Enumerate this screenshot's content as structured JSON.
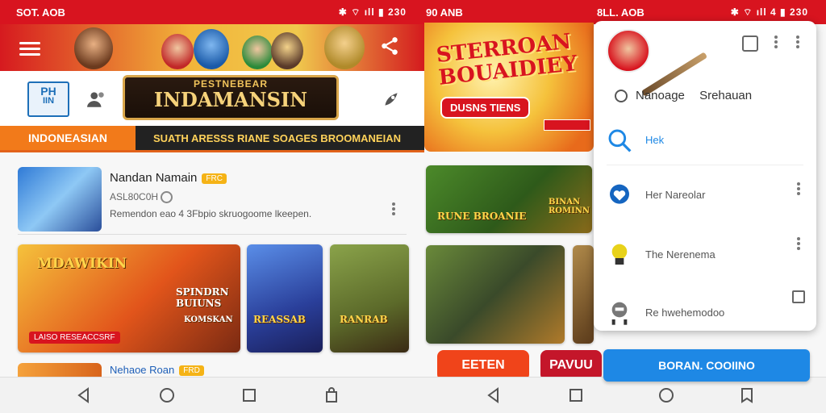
{
  "left_screen": {
    "status": {
      "time": "SOT. AOB",
      "right": "✱ ⌔ ıll ▮ 230"
    },
    "banner": {
      "logo_text": "PH",
      "logo_text2": "IIN",
      "title_small": "PESTNEBEAR",
      "title_main": "INDAMANSIN"
    },
    "ticker": {
      "label": "INDONEASIAN",
      "text": "SUATH ARESSS RIANE SOAGES BROOMANEIAN"
    },
    "featured_app": {
      "title": "Nandan Namain",
      "badge": "FRC",
      "meta": "ASL80C0H",
      "description": "Remendon eao 4 3Fbpio skruogoome lkeepen."
    },
    "tiles": [
      {
        "label": "MDAWIKIN"
      },
      {
        "label": "SPINDRN BUIUNS",
        "sub": "KOMSKAN"
      },
      {
        "label": "REASSAB"
      },
      {
        "label": "RANRAB"
      }
    ],
    "tile_tag": "LAISO RESEACCSRF",
    "second_app": {
      "title": "Nehaoe Roan",
      "badge": "FRD"
    }
  },
  "right_screen": {
    "status": {
      "time": "90 ANB",
      "center": "8LL. AOB",
      "right": "✱ ⌔ ıll 4 ▮ 230"
    },
    "promo": {
      "headline_line1": "STERROAN",
      "headline_line2": "BOUAIDIEY",
      "button": "DUSNS TIENS"
    },
    "grid_tiles": [
      {
        "label": "RUNE BROANIE",
        "side": "BINAN ROMINN"
      },
      {
        "label": "",
        "side": ""
      }
    ],
    "buttons": {
      "left": "EETEN",
      "right": "PAVUU"
    },
    "drawer": {
      "title_left": "Nanoage",
      "title_right": "Srehauan",
      "items": [
        {
          "label": "Hek",
          "icon": "search-icon",
          "accent": true
        },
        {
          "label": "Her Nareolar",
          "icon": "heart-icon"
        },
        {
          "label": "The Nerenema",
          "icon": "bulb-icon"
        },
        {
          "label": "Re hwehemodoo",
          "icon": "robot-icon"
        }
      ],
      "button": "BORAN. COOIINO"
    }
  },
  "colors": {
    "brand_red": "#d8141f",
    "accent_blue": "#1e88e5",
    "badge_orange": "#f5b316"
  }
}
